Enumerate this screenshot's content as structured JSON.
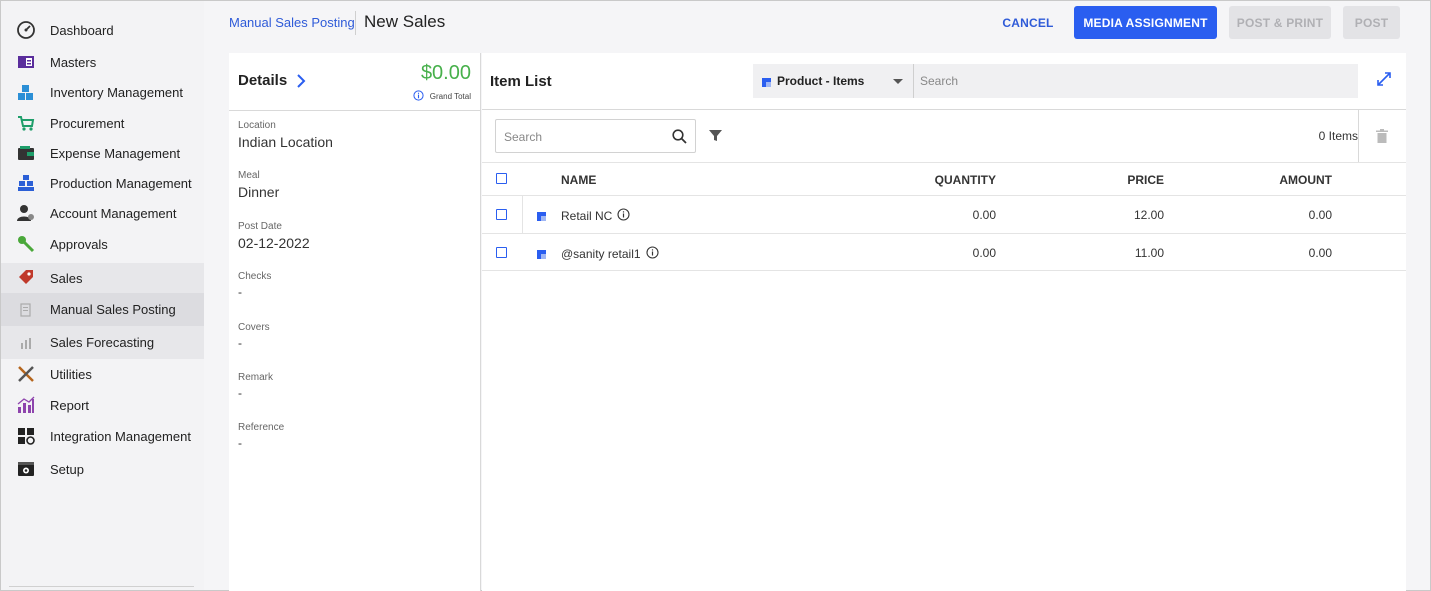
{
  "sidebar": {
    "items": [
      {
        "label": "Dashboard",
        "icon": "dashboard-gauge-icon"
      },
      {
        "label": "Masters",
        "icon": "masters-book-icon"
      },
      {
        "label": "Inventory Management",
        "icon": "inventory-boxes-icon"
      },
      {
        "label": "Procurement",
        "icon": "procurement-cart-icon"
      },
      {
        "label": "Expense Management",
        "icon": "expense-wallet-icon"
      },
      {
        "label": "Production Management",
        "icon": "production-stack-icon"
      },
      {
        "label": "Account Management",
        "icon": "account-user-gear-icon"
      },
      {
        "label": "Approvals",
        "icon": "approvals-key-icon"
      },
      {
        "label": "Sales",
        "icon": "sales-tag-icon"
      },
      {
        "label": "Manual Sales Posting",
        "icon": "manual-posting-icon"
      },
      {
        "label": "Sales Forecasting",
        "icon": "forecast-chart-icon"
      },
      {
        "label": "Utilities",
        "icon": "utilities-tools-icon"
      },
      {
        "label": "Report",
        "icon": "report-chart-icon"
      },
      {
        "label": "Integration Management",
        "icon": "integration-grid-icon"
      },
      {
        "label": "Setup",
        "icon": "setup-gear-icon"
      }
    ]
  },
  "header": {
    "breadcrumb": "Manual Sales Posting",
    "title": "New Sales",
    "cancel_label": "CANCEL",
    "media_label": "MEDIA ASSIGNMENT",
    "post_print_label": "POST & PRINT",
    "post_label": "POST"
  },
  "details": {
    "title": "Details",
    "grand_total": "$0.00",
    "grand_total_label": "Grand Total",
    "fields": [
      {
        "label": "Location",
        "value": "Indian Location"
      },
      {
        "label": "Meal",
        "value": "Dinner"
      },
      {
        "label": "Post Date",
        "value": "02-12-2022"
      },
      {
        "label": "Checks",
        "value": "-"
      },
      {
        "label": "Covers",
        "value": "-"
      },
      {
        "label": "Remark",
        "value": "-"
      },
      {
        "label": "Reference",
        "value": "-"
      }
    ]
  },
  "item_list": {
    "title": "Item List",
    "type_select": "Product - Items",
    "search_placeholder": "Search",
    "sub_search_placeholder": "Search",
    "count": "0 Items",
    "columns": {
      "name": "NAME",
      "quantity": "QUANTITY",
      "price": "PRICE",
      "amount": "AMOUNT"
    },
    "rows": [
      {
        "name": "Retail NC",
        "quantity": "0.00",
        "price": "12.00",
        "amount": "0.00"
      },
      {
        "name": "@sanity retail1",
        "quantity": "0.00",
        "price": "11.00",
        "amount": "0.00"
      }
    ]
  },
  "colors": {
    "accent": "#2a5ef0",
    "link": "#2f5bd8",
    "total_green": "#47b04b"
  }
}
